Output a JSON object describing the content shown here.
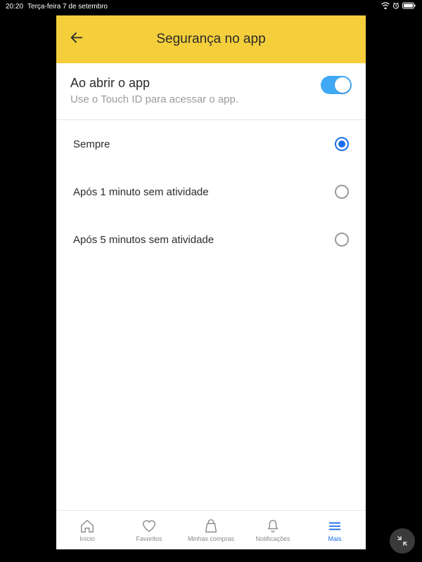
{
  "statusBar": {
    "time": "20:20",
    "date": "Terça-feira 7 de setembro"
  },
  "header": {
    "title": "Segurança no app"
  },
  "mainSection": {
    "title": "Ao abrir o app",
    "description": "Use o Touch ID para acessar o app.",
    "toggleOn": true
  },
  "options": [
    {
      "label": "Sempre",
      "selected": true
    },
    {
      "label": "Após 1 minuto sem atividade",
      "selected": false
    },
    {
      "label": "Após 5 minutos sem atividade",
      "selected": false
    }
  ],
  "bottomNav": {
    "items": [
      {
        "label": "Início",
        "active": false
      },
      {
        "label": "Favoritos",
        "active": false
      },
      {
        "label": "Minhas compras",
        "active": false
      },
      {
        "label": "Notificações",
        "active": false
      },
      {
        "label": "Mais",
        "active": true
      }
    ]
  }
}
